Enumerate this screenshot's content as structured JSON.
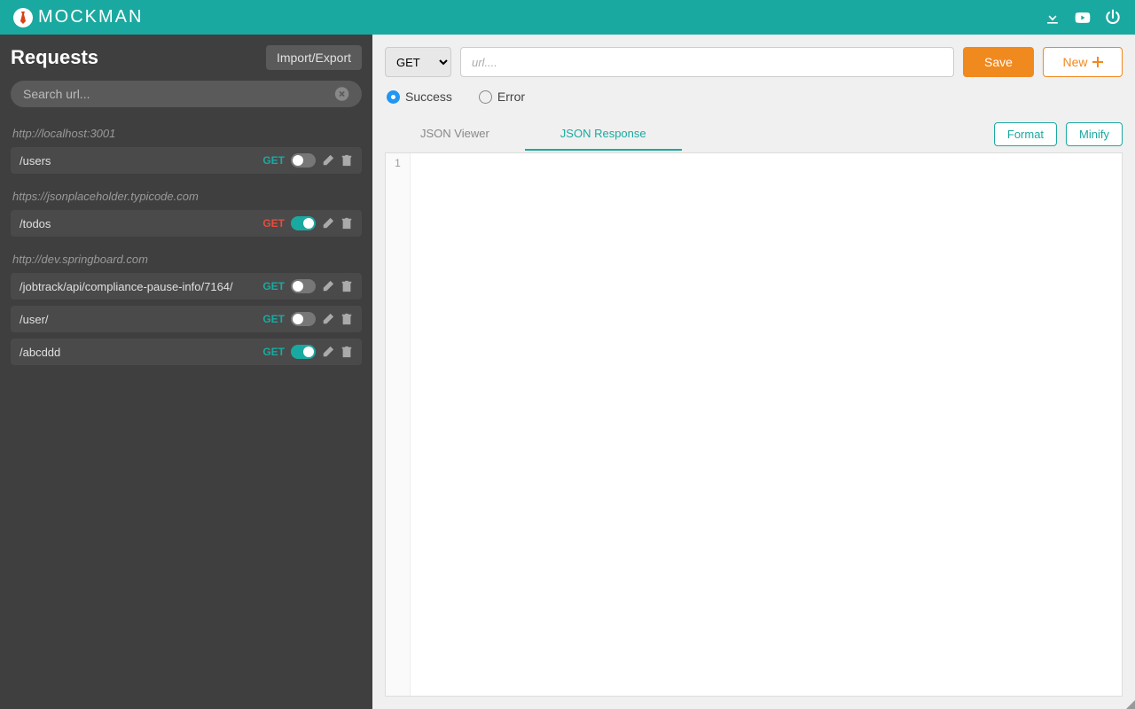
{
  "header": {
    "brand": "MOCKMAN"
  },
  "sidebar": {
    "title": "Requests",
    "import_export": "Import/Export",
    "search_placeholder": "Search url...",
    "groups": [
      {
        "host": "http://localhost:3001",
        "requests": [
          {
            "path": "/users",
            "method": "GET",
            "method_class": "teal",
            "enabled": false
          }
        ]
      },
      {
        "host": "https://jsonplaceholder.typicode.com",
        "requests": [
          {
            "path": "/todos",
            "method": "GET",
            "method_class": "red",
            "enabled": true
          }
        ]
      },
      {
        "host": "http://dev.springboard.com",
        "requests": [
          {
            "path": "/jobtrack/api/compliance-pause-info/7164/",
            "method": "GET",
            "method_class": "teal",
            "enabled": false
          },
          {
            "path": "/user/",
            "method": "GET",
            "method_class": "teal",
            "enabled": false
          },
          {
            "path": "/abcddd",
            "method": "GET",
            "method_class": "teal",
            "enabled": true
          }
        ]
      }
    ]
  },
  "content": {
    "method_selected": "GET",
    "url_placeholder": "url....",
    "save": "Save",
    "new": "New",
    "radios": {
      "success": "Success",
      "error": "Error",
      "selected": "success"
    },
    "tabs": {
      "viewer": "JSON Viewer",
      "response": "JSON Response",
      "active": "response"
    },
    "format": "Format",
    "minify": "Minify",
    "editor_line": "1"
  }
}
